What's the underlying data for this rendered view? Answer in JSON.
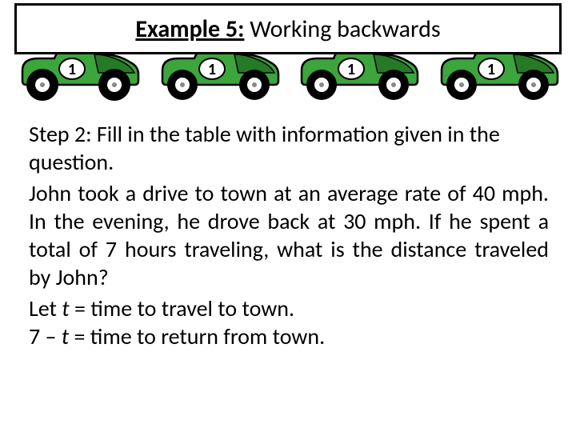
{
  "title": {
    "label": "Example 5:",
    "text": " Working backwards"
  },
  "step": {
    "text": "Step 2: Fill in the table with information given in the question."
  },
  "problem": {
    "text": "John took a drive to town at an average rate of 40 mph. In the evening, he drove back at 30 mph. If he spent a total of 7 hours traveling, what is the distance traveled by John?"
  },
  "let1": {
    "prefix": "Let ",
    "var": "t",
    "suffix": " = time to travel to town."
  },
  "let2": {
    "prefix": "7 – ",
    "var": "t",
    "suffix": " = time to return from town."
  },
  "car": {
    "number": "1",
    "driver_number": "1",
    "body_color": "#3ca53c",
    "body_stroke": "#000",
    "wheel_fill": "#000",
    "hub_fill": "#fff"
  }
}
